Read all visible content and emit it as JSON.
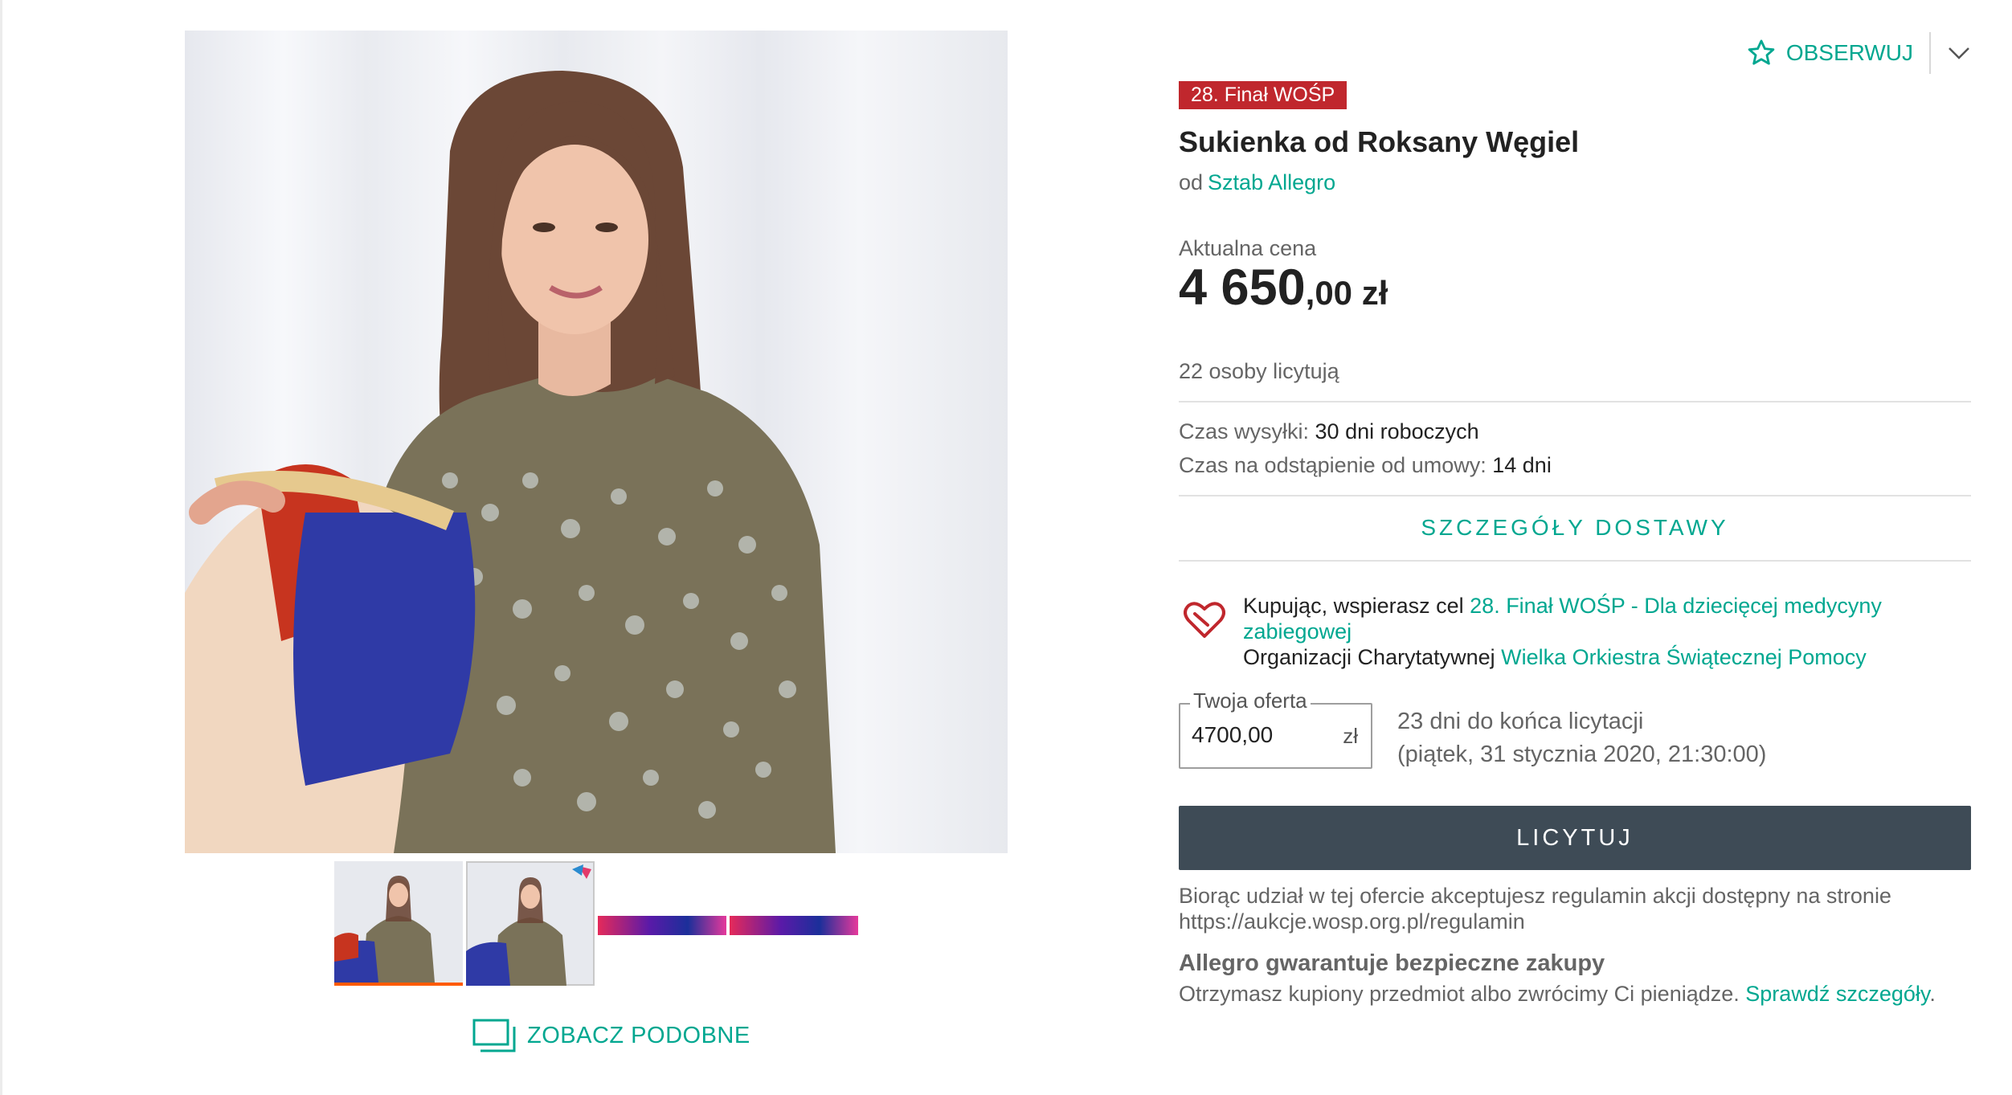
{
  "watch": {
    "label": "OBSERWUJ",
    "icon": "star-outline-icon",
    "dropdown_icon": "chevron-down-icon"
  },
  "offer": {
    "badge": "28. Finał WOŚP",
    "title": "Sukienka od Roksany Węgiel",
    "seller_prefix": "od",
    "seller_name": "Sztab Allegro",
    "price_label": "Aktualna cena",
    "price_main": "4 650",
    "price_fraction": ",00 zł",
    "bidders": "22 osoby licytują"
  },
  "shipping": {
    "time_label": "Czas wysyłki:",
    "time_value": "30 dni roboczych",
    "return_label": "Czas na odstąpienie od umowy:",
    "return_value": "14 dni",
    "details_button": "SZCZEGÓŁY DOSTAWY"
  },
  "charity": {
    "icon": "heart-icon",
    "prefix": "Kupując, wspierasz cel",
    "goal": "28. Finał WOŚP - Dla dziecięcej medycyny zabiegowej",
    "org_prefix": "Organizacji Charytatywnej",
    "org_name": "Wielka Orkiestra Świątecznej Pomocy"
  },
  "bid": {
    "field_label": "Twoja oferta",
    "field_value": "4700,00",
    "unit": "zł",
    "time_left": "23 dni do końca licytacji",
    "end_date": "(piątek, 31 stycznia 2020, 21:30:00)",
    "button": "LICYTUJ"
  },
  "terms": {
    "text": "Biorąc udział w tej ofercie akceptujesz regulamin akcji dostępny na stronie",
    "url": "https://aukcje.wosp.org.pl/regulamin"
  },
  "guarantee": {
    "title": "Allegro gwarantuje bezpieczne zakupy",
    "text": "Otrzymasz kupiony przedmiot albo zwrócimy Ci pieniądze.",
    "link": "Sprawdź szczegóły",
    "suffix": "."
  },
  "gallery": {
    "similar_label": "ZOBACZ PODOBNE",
    "similar_icon": "gallery-icon",
    "thumbs": [
      "photo-1",
      "photo-2",
      "banner-1",
      "banner-2"
    ],
    "colors": {
      "accent": "#00a790",
      "badge": "#c0272d",
      "button": "#3e4b56",
      "active_thumb": "#ff5a00"
    }
  }
}
